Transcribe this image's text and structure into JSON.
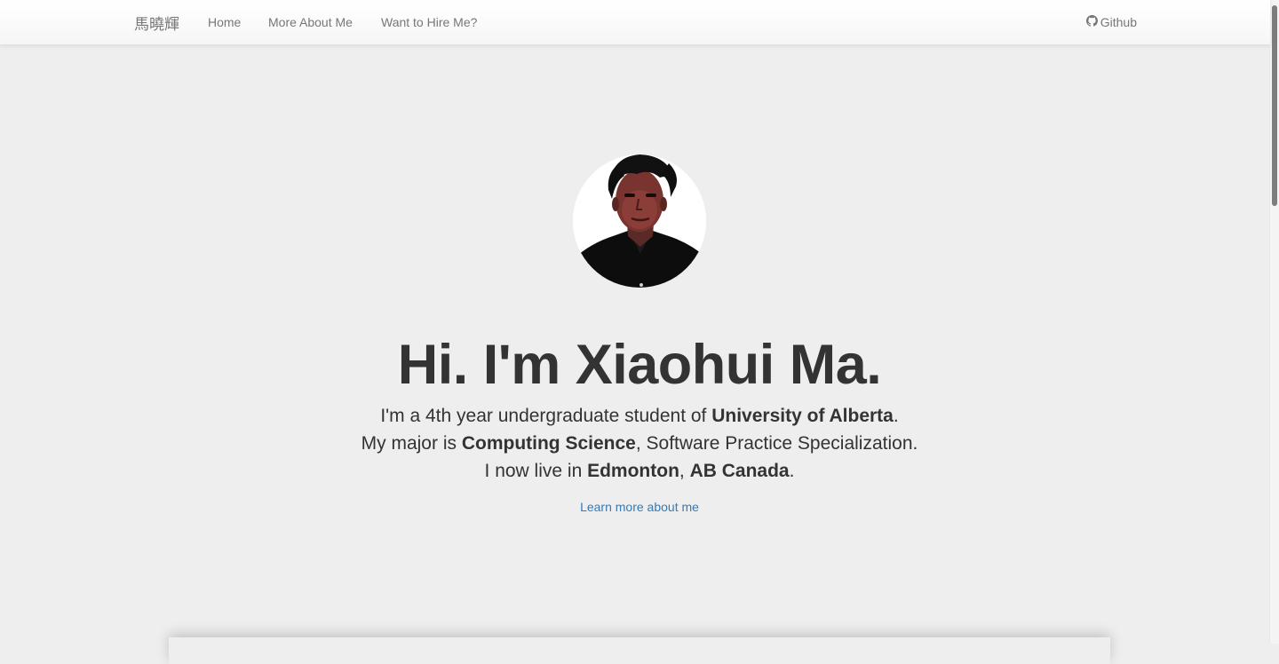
{
  "nav": {
    "brand": "馬曉輝",
    "links": [
      {
        "label": "Home"
      },
      {
        "label": "More About Me"
      },
      {
        "label": "Want to Hire Me?"
      }
    ],
    "github": {
      "label": "Github",
      "icon": "github-icon"
    }
  },
  "hero": {
    "avatar_alt": "Xiaohui Ma portrait",
    "headline": "Hi. I'm Xiaohui Ma.",
    "headline_parts": {
      "greeting": "Hi. I'm ",
      "name": "Xiaohui Ma."
    },
    "lines": [
      {
        "pre": "I'm a 4th year undergraduate student of ",
        "bold": "University of Alberta",
        "post": "."
      },
      {
        "pre": "My major is ",
        "bold": "Computing Science",
        "post": ", Software Practice Specialization."
      },
      {
        "pre": "I now live in ",
        "bold": "Edmonton",
        "mid": ", ",
        "bold2": "AB Canada",
        "post": "."
      }
    ],
    "learn_more": "Learn more about me"
  },
  "colors": {
    "background": "#eeeeee",
    "text": "#333333",
    "nav_text": "#777777",
    "link": "#337ab7"
  }
}
